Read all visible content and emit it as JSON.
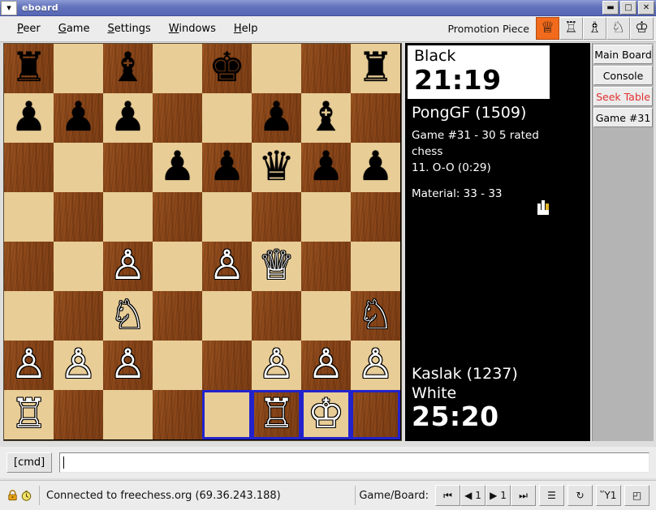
{
  "window": {
    "title": "eboard",
    "menu_icon": "chevron-down-icon",
    "minimize_label": "–",
    "maximize_label": "❐",
    "close_label": "✕"
  },
  "menubar": {
    "items": [
      {
        "label": "Peer",
        "mnemonic": "P"
      },
      {
        "label": "Game",
        "mnemonic": "G"
      },
      {
        "label": "Settings",
        "mnemonic": "S"
      },
      {
        "label": "Windows",
        "mnemonic": "W"
      },
      {
        "label": "Help",
        "mnemonic": "H"
      }
    ]
  },
  "promotion": {
    "label": "Promotion Piece",
    "selected": "queen",
    "selected_color": "#f26a1b",
    "pieces": [
      {
        "name": "queen",
        "glyph": "♕"
      },
      {
        "name": "rook",
        "glyph": "♖"
      },
      {
        "name": "bishop",
        "glyph": "♗"
      },
      {
        "name": "knight",
        "glyph": "♘"
      },
      {
        "name": "king",
        "glyph": "♔"
      }
    ]
  },
  "board": {
    "orientation": "white",
    "light_square_color": "#e8cd96",
    "dark_square_color": "#8c4a1b",
    "highlight_color": "#2222cc",
    "highlighted_squares": [
      "e1",
      "f1",
      "g1",
      "h1"
    ],
    "ranks": [
      {
        "rank": 8,
        "squares": [
          {
            "file": "a",
            "piece": "black-rook",
            "glyph": "♜",
            "color": "black"
          },
          {
            "file": "b",
            "piece": null,
            "glyph": "",
            "color": null
          },
          {
            "file": "c",
            "piece": "black-bishop",
            "glyph": "♝",
            "color": "black"
          },
          {
            "file": "d",
            "piece": null,
            "glyph": "",
            "color": null
          },
          {
            "file": "e",
            "piece": "black-king",
            "glyph": "♚",
            "color": "black"
          },
          {
            "file": "f",
            "piece": null,
            "glyph": "",
            "color": null
          },
          {
            "file": "g",
            "piece": null,
            "glyph": "",
            "color": null
          },
          {
            "file": "h",
            "piece": "black-rook",
            "glyph": "♜",
            "color": "black"
          }
        ]
      },
      {
        "rank": 7,
        "squares": [
          {
            "file": "a",
            "piece": "black-pawn",
            "glyph": "♟",
            "color": "black"
          },
          {
            "file": "b",
            "piece": "black-pawn",
            "glyph": "♟",
            "color": "black"
          },
          {
            "file": "c",
            "piece": "black-pawn",
            "glyph": "♟",
            "color": "black"
          },
          {
            "file": "d",
            "piece": null,
            "glyph": "",
            "color": null
          },
          {
            "file": "e",
            "piece": null,
            "glyph": "",
            "color": null
          },
          {
            "file": "f",
            "piece": "black-pawn",
            "glyph": "♟",
            "color": "black"
          },
          {
            "file": "g",
            "piece": "black-bishop",
            "glyph": "♝",
            "color": "black"
          },
          {
            "file": "h",
            "piece": null,
            "glyph": "",
            "color": null
          }
        ]
      },
      {
        "rank": 6,
        "squares": [
          {
            "file": "a",
            "piece": null,
            "glyph": "",
            "color": null
          },
          {
            "file": "b",
            "piece": null,
            "glyph": "",
            "color": null
          },
          {
            "file": "c",
            "piece": null,
            "glyph": "",
            "color": null
          },
          {
            "file": "d",
            "piece": "black-pawn",
            "glyph": "♟",
            "color": "black"
          },
          {
            "file": "e",
            "piece": "black-pawn",
            "glyph": "♟",
            "color": "black"
          },
          {
            "file": "f",
            "piece": "black-queen",
            "glyph": "♛",
            "color": "black"
          },
          {
            "file": "g",
            "piece": "black-pawn",
            "glyph": "♟",
            "color": "black"
          },
          {
            "file": "h",
            "piece": "black-pawn",
            "glyph": "♟",
            "color": "black"
          }
        ]
      },
      {
        "rank": 5,
        "squares": [
          {
            "file": "a",
            "piece": null,
            "glyph": "",
            "color": null
          },
          {
            "file": "b",
            "piece": null,
            "glyph": "",
            "color": null
          },
          {
            "file": "c",
            "piece": null,
            "glyph": "",
            "color": null
          },
          {
            "file": "d",
            "piece": null,
            "glyph": "",
            "color": null
          },
          {
            "file": "e",
            "piece": null,
            "glyph": "",
            "color": null
          },
          {
            "file": "f",
            "piece": null,
            "glyph": "",
            "color": null
          },
          {
            "file": "g",
            "piece": null,
            "glyph": "",
            "color": null
          },
          {
            "file": "h",
            "piece": null,
            "glyph": "",
            "color": null
          }
        ]
      },
      {
        "rank": 4,
        "squares": [
          {
            "file": "a",
            "piece": null,
            "glyph": "",
            "color": null
          },
          {
            "file": "b",
            "piece": null,
            "glyph": "",
            "color": null
          },
          {
            "file": "c",
            "piece": "white-pawn",
            "glyph": "♙",
            "color": "white"
          },
          {
            "file": "d",
            "piece": null,
            "glyph": "",
            "color": null
          },
          {
            "file": "e",
            "piece": "white-pawn",
            "glyph": "♙",
            "color": "white"
          },
          {
            "file": "f",
            "piece": "white-queen",
            "glyph": "♕",
            "color": "white"
          },
          {
            "file": "g",
            "piece": null,
            "glyph": "",
            "color": null
          },
          {
            "file": "h",
            "piece": null,
            "glyph": "",
            "color": null
          }
        ]
      },
      {
        "rank": 3,
        "squares": [
          {
            "file": "a",
            "piece": null,
            "glyph": "",
            "color": null
          },
          {
            "file": "b",
            "piece": null,
            "glyph": "",
            "color": null
          },
          {
            "file": "c",
            "piece": "white-knight",
            "glyph": "♘",
            "color": "white"
          },
          {
            "file": "d",
            "piece": null,
            "glyph": "",
            "color": null
          },
          {
            "file": "e",
            "piece": null,
            "glyph": "",
            "color": null
          },
          {
            "file": "f",
            "piece": null,
            "glyph": "",
            "color": null
          },
          {
            "file": "g",
            "piece": null,
            "glyph": "",
            "color": null
          },
          {
            "file": "h",
            "piece": "white-knight",
            "glyph": "♘",
            "color": "white"
          }
        ]
      },
      {
        "rank": 2,
        "squares": [
          {
            "file": "a",
            "piece": "white-pawn",
            "glyph": "♙",
            "color": "white"
          },
          {
            "file": "b",
            "piece": "white-pawn",
            "glyph": "♙",
            "color": "white"
          },
          {
            "file": "c",
            "piece": "white-pawn",
            "glyph": "♙",
            "color": "white"
          },
          {
            "file": "d",
            "piece": null,
            "glyph": "",
            "color": null
          },
          {
            "file": "e",
            "piece": null,
            "glyph": "",
            "color": null
          },
          {
            "file": "f",
            "piece": "white-pawn",
            "glyph": "♙",
            "color": "white"
          },
          {
            "file": "g",
            "piece": "white-pawn",
            "glyph": "♙",
            "color": "white"
          },
          {
            "file": "h",
            "piece": "white-pawn",
            "glyph": "♙",
            "color": "white"
          }
        ]
      },
      {
        "rank": 1,
        "squares": [
          {
            "file": "a",
            "piece": "white-rook",
            "glyph": "♖",
            "color": "white"
          },
          {
            "file": "b",
            "piece": null,
            "glyph": "",
            "color": null
          },
          {
            "file": "c",
            "piece": null,
            "glyph": "",
            "color": null
          },
          {
            "file": "d",
            "piece": null,
            "glyph": "",
            "color": null
          },
          {
            "file": "e",
            "piece": null,
            "glyph": "",
            "color": null
          },
          {
            "file": "f",
            "piece": "white-rook",
            "glyph": "♖",
            "color": "white"
          },
          {
            "file": "g",
            "piece": "white-king",
            "glyph": "♔",
            "color": "white"
          },
          {
            "file": "h",
            "piece": null,
            "glyph": "",
            "color": null
          }
        ]
      }
    ]
  },
  "info": {
    "black": {
      "color_label": "Black",
      "clock": "21:19",
      "player": "PongGF (1509)"
    },
    "game_line_1": "Game #31 - 30 5 rated",
    "game_line_2": "chess",
    "game_line_3": "11. O-O (0:29)",
    "material": "Material: 33 - 33",
    "white": {
      "player": "Kaslak (1237)",
      "color_label": "White",
      "clock": "25:20"
    }
  },
  "tabs": [
    {
      "label": "Main Board",
      "state": "normal"
    },
    {
      "label": "Console",
      "state": "normal"
    },
    {
      "label": "Seek Table",
      "state": "alert"
    },
    {
      "label": "Game #31",
      "state": "normal"
    }
  ],
  "command": {
    "button_label": "[cmd]",
    "value": "",
    "placeholder": ""
  },
  "status": {
    "lock_icon": "lock-icon",
    "clock_icon": "clock-icon",
    "text": "Connected to freechess.org (69.36.243.188)",
    "game_board_label": "Game/Board:",
    "nav_buttons": [
      {
        "name": "first-move-button",
        "glyph": "⏮"
      },
      {
        "name": "back-one-move-button",
        "glyph": "◀ 1"
      },
      {
        "name": "forward-one-move-button",
        "glyph": "▶ 1"
      },
      {
        "name": "last-move-button",
        "glyph": "⏭"
      },
      {
        "name": "move-list-button",
        "glyph": "☰"
      },
      {
        "name": "refresh-board-button",
        "glyph": "↻"
      },
      {
        "name": "trash-board-button",
        "glyph": "Ὕ1"
      },
      {
        "name": "flip-board-button",
        "glyph": "◰"
      }
    ]
  }
}
